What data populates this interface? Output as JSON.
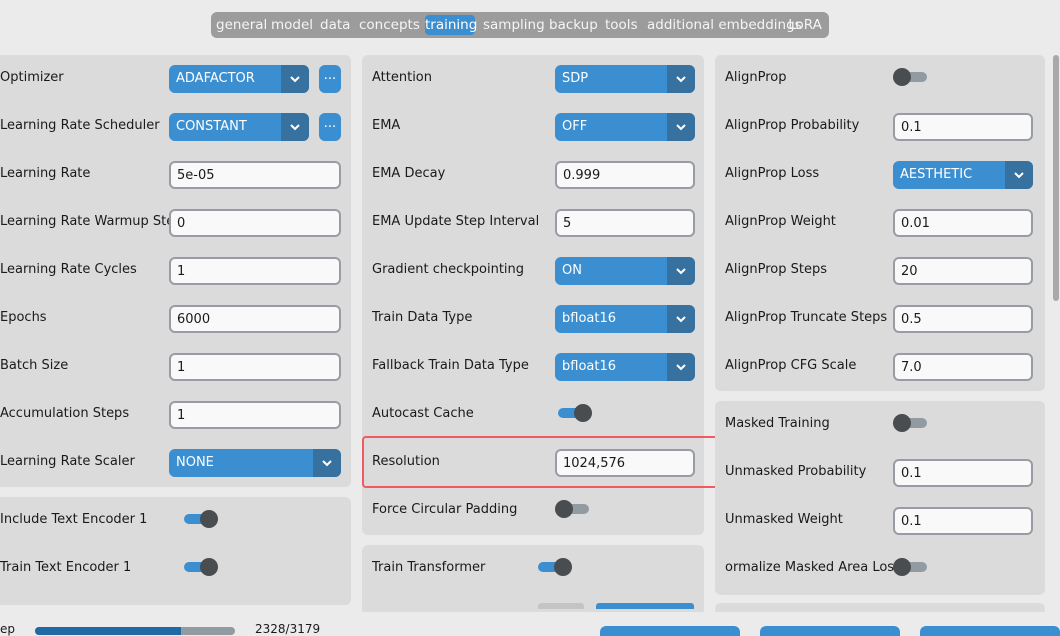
{
  "tabs": [
    "general",
    "model",
    "data",
    "concepts",
    "training",
    "sampling",
    "backup",
    "tools",
    "additional embeddings",
    "LoRA"
  ],
  "active_tab": "training",
  "optimizer_panel": {
    "optimizer_label": "Optimizer",
    "optimizer_value": "ADAFACTOR",
    "optimizer_more": "...",
    "scheduler_label": "Learning Rate Scheduler",
    "scheduler_value": "CONSTANT",
    "scheduler_more": "...",
    "lr_label": "Learning Rate",
    "lr_value": "5e-05",
    "warmup_label": "Learning Rate Warmup Step",
    "warmup_value": "0",
    "cycles_label": "Learning Rate Cycles",
    "cycles_value": "1",
    "epochs_label": "Epochs",
    "epochs_value": "6000",
    "batch_label": "Batch Size",
    "batch_value": "1",
    "accum_label": "Accumulation Steps",
    "accum_value": "1",
    "scaler_label": "Learning Rate Scaler",
    "scaler_value": "NONE"
  },
  "text_encoder_panel": {
    "include_label": "Include Text Encoder 1",
    "include_on": true,
    "train_label": "Train Text Encoder 1",
    "train_on": true
  },
  "middle_panel": {
    "attention_label": "Attention",
    "attention_value": "SDP",
    "ema_label": "EMA",
    "ema_value": "OFF",
    "ema_decay_label": "EMA Decay",
    "ema_decay_value": "0.999",
    "ema_interval_label": "EMA Update Step Interval",
    "ema_interval_value": "5",
    "grad_ckpt_label": "Gradient checkpointing",
    "grad_ckpt_value": "ON",
    "dtype_label": "Train Data Type",
    "dtype_value": "bfloat16",
    "fallback_label": "Fallback Train Data Type",
    "fallback_value": "bfloat16",
    "autocast_label": "Autocast Cache",
    "autocast_on": true,
    "resolution_label": "Resolution",
    "resolution_value": "1024,576",
    "circular_label": "Force Circular Padding",
    "circular_on": false
  },
  "transformer_panel": {
    "train_label": "Train Transformer",
    "train_on": true
  },
  "alignprop_panel": {
    "alignprop_label": "AlignProp",
    "alignprop_on": false,
    "prob_label": "AlignProp Probability",
    "prob_value": "0.1",
    "loss_label": "AlignProp Loss",
    "loss_value": "AESTHETIC",
    "weight_label": "AlignProp Weight",
    "weight_value": "0.01",
    "steps_label": "AlignProp Steps",
    "steps_value": "20",
    "truncate_label": "AlignProp Truncate Steps",
    "truncate_value": "0.5",
    "cfg_label": "AlignProp CFG Scale",
    "cfg_value": "7.0"
  },
  "masked_panel": {
    "masked_label": "Masked Training",
    "masked_on": false,
    "unmasked_prob_label": "Unmasked Probability",
    "unmasked_prob_value": "0.1",
    "unmasked_weight_label": "Unmasked Weight",
    "unmasked_weight_value": "0.1",
    "normalize_label": "ormalize Masked Area Los",
    "normalize_on": false
  },
  "status": {
    "step_label": "ep",
    "progress": "2328/3179",
    "progress_fraction": 0.7323
  },
  "colors": {
    "accent": "#3b8ed0",
    "accent_dark": "#36719f",
    "highlight": "#ef5a63",
    "panel_bg": "#dbdbdb",
    "window_bg": "#ebebeb"
  }
}
